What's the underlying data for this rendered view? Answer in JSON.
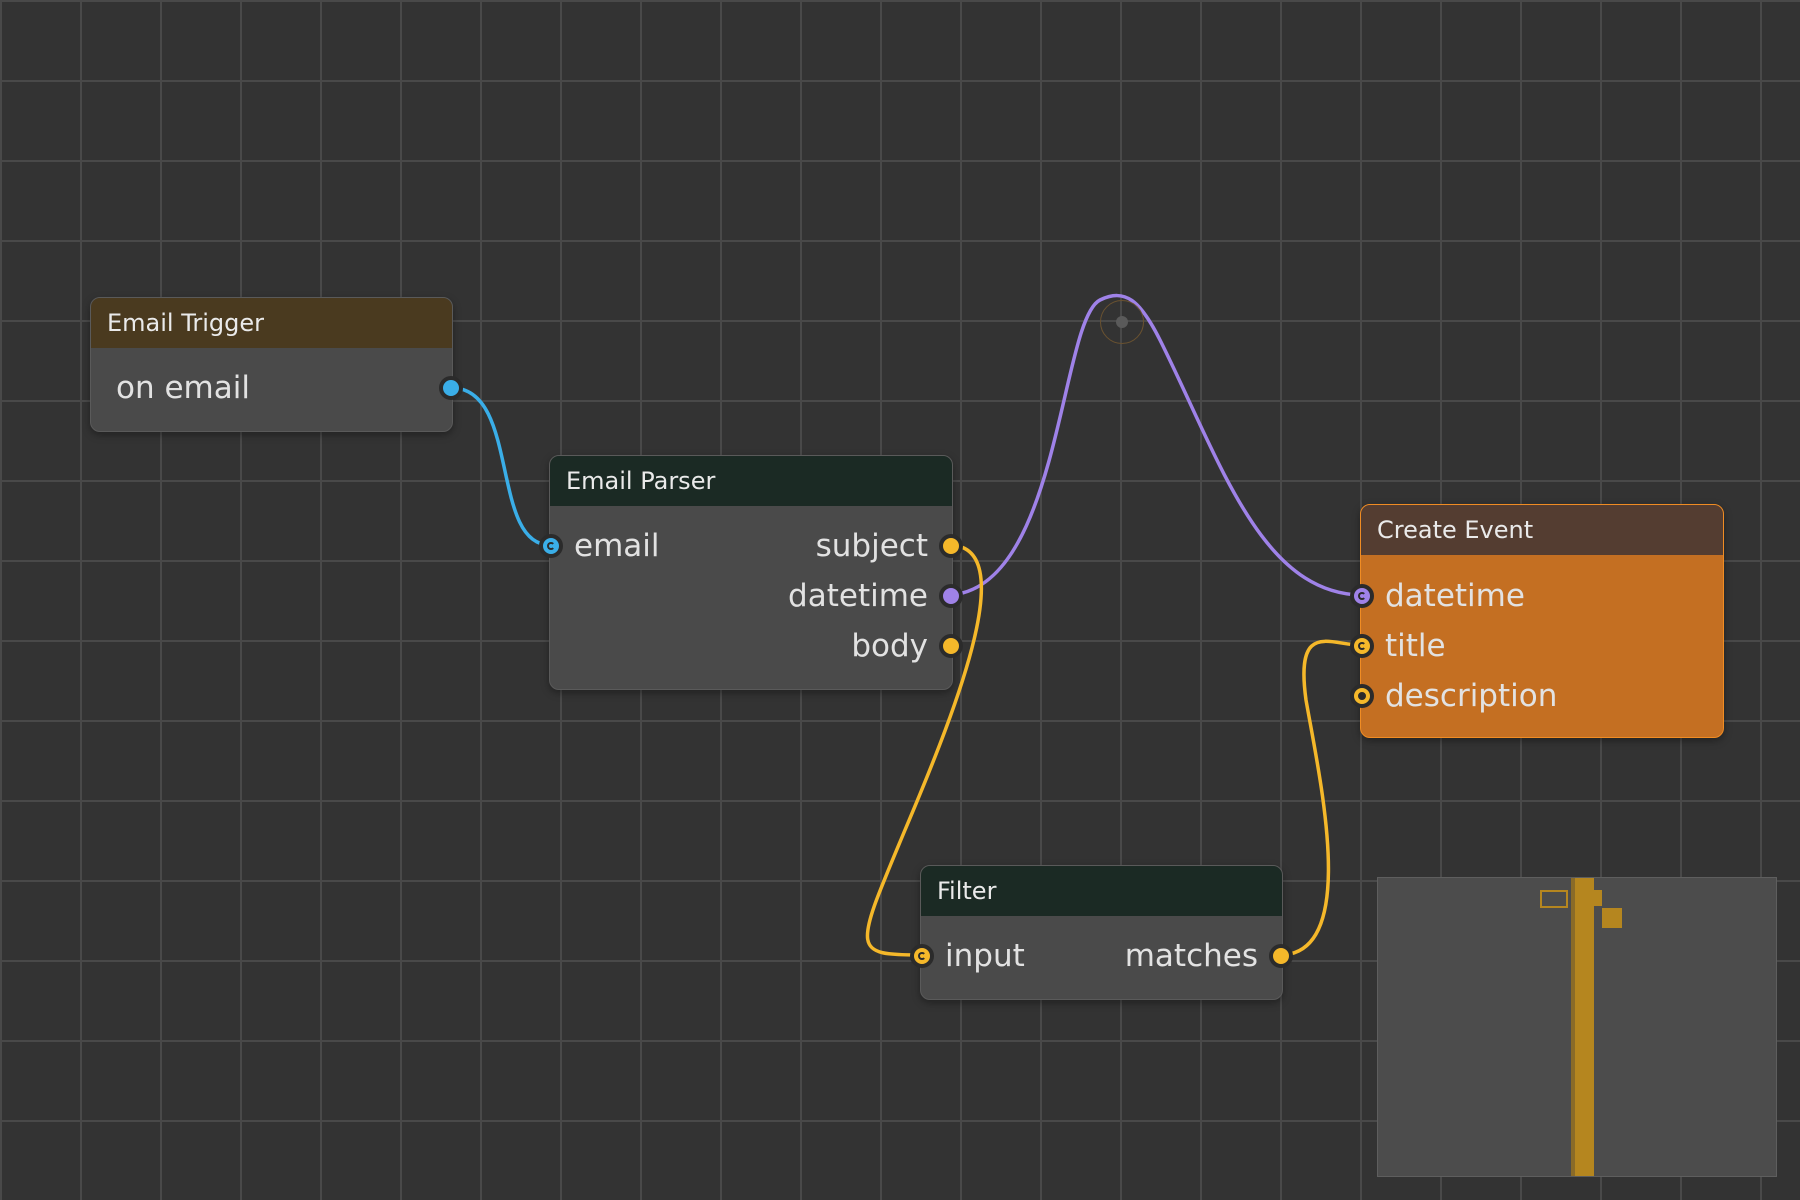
{
  "colors": {
    "blue": "#3aaee8",
    "yellow": "#f5b82a",
    "purple": "#9f82e8",
    "orange_body": "#c46f22",
    "orange_border": "#f08c23"
  },
  "nodes": {
    "email_trigger": {
      "title": "Email Trigger",
      "outputs": [
        "on email"
      ]
    },
    "email_parser": {
      "title": "Email Parser",
      "inputs": [
        "email"
      ],
      "outputs": [
        "subject",
        "datetime",
        "body"
      ]
    },
    "create_event": {
      "title": "Create Event",
      "inputs": [
        "datetime",
        "title",
        "description"
      ]
    },
    "filter": {
      "title": "Filter",
      "inputs": [
        "input"
      ],
      "outputs": [
        "matches"
      ]
    }
  }
}
